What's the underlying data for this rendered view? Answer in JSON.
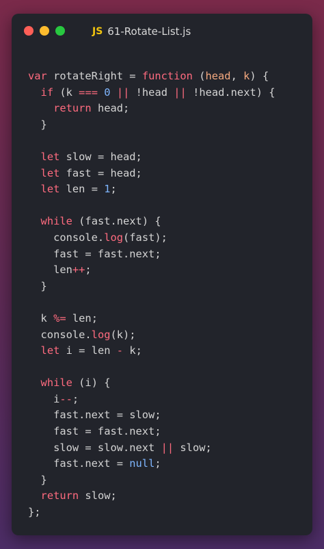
{
  "window": {
    "tab_icon": "JS",
    "tab_title": "61-Rotate-List.js"
  },
  "code_lines": [
    "var rotateRight = function (head, k) {",
    "  if (k === 0 || !head || !head.next) {",
    "    return head;",
    "  }",
    "",
    "  let slow = head;",
    "  let fast = head;",
    "  let len = 1;",
    "",
    "  while (fast.next) {",
    "    console.log(fast);",
    "    fast = fast.next;",
    "    len++;",
    "  }",
    "",
    "  k %= len;",
    "  console.log(k);",
    "  let i = len - k;",
    "",
    "  while (i) {",
    "    i--;",
    "    fast.next = slow;",
    "    fast = fast.next;",
    "    slow = slow.next || slow;",
    "    fast.next = null;",
    "  }",
    "  return slow;",
    "};"
  ],
  "colors": {
    "keyword": "#ff6b7f",
    "parameter": "#f5a97f",
    "number": "#7fb6ff",
    "text": "#d4d4d4",
    "background": "#22242b"
  }
}
